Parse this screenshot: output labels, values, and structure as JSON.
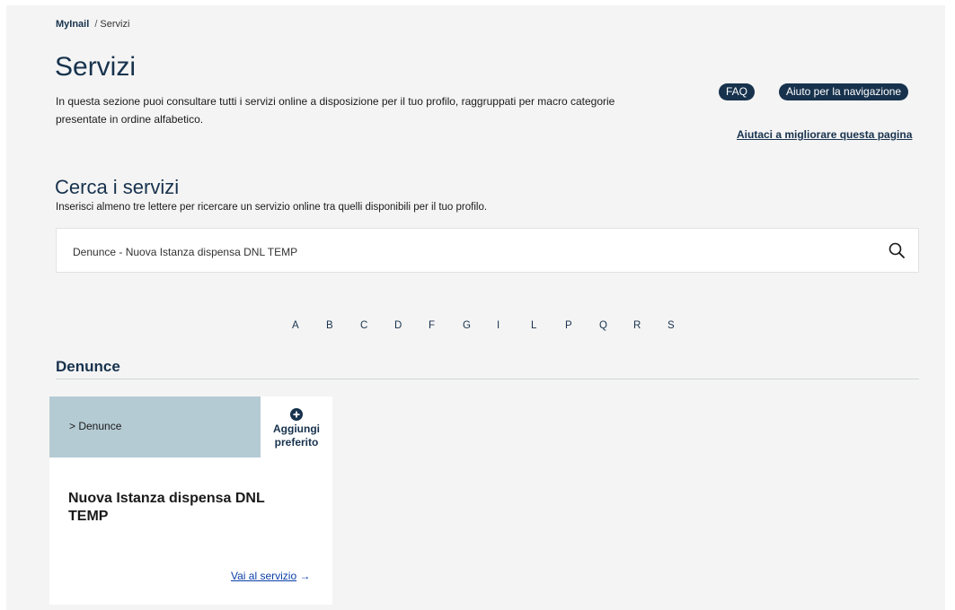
{
  "breadcrumb": {
    "root": "MyInail",
    "separator": "/",
    "current": "Servizi"
  },
  "header": {
    "title": "Servizi",
    "description": "In questa sezione puoi consultare tutti i servizi online a disposizione per il tuo profilo, raggruppati per macro categorie presentate in ordine alfabetico.",
    "faq_label": "FAQ",
    "help_label": "Aiuto per la navigazione",
    "improve_link": "Aiutaci a migliorare questa pagina"
  },
  "search": {
    "title": "Cerca i servizi",
    "hint": "Inserisci almeno tre lettere per ricercare un servizio online tra quelli disponibili per il tuo profilo.",
    "value": "Denunce - Nuova Istanza dispensa DNL TEMP",
    "icon": "search-icon"
  },
  "alphabet": [
    "A",
    "B",
    "C",
    "D",
    "F",
    "G",
    "I",
    "L",
    "P",
    "Q",
    "R",
    "S"
  ],
  "section": {
    "title": "Denunce",
    "card": {
      "category": "> Denunce",
      "favorite_line1": "Aggiungi",
      "favorite_line2": "preferito",
      "favorite_icon": "plus-circle-icon",
      "title": "Nuova Istanza dispensa DNL TEMP",
      "link_label": "Vai al servizio",
      "link_arrow": "→"
    }
  },
  "colors": {
    "primary": "#17324d",
    "page_background": "#f4f4f4",
    "card_header": "#b5cbd4",
    "link": "#0b3fa8"
  }
}
